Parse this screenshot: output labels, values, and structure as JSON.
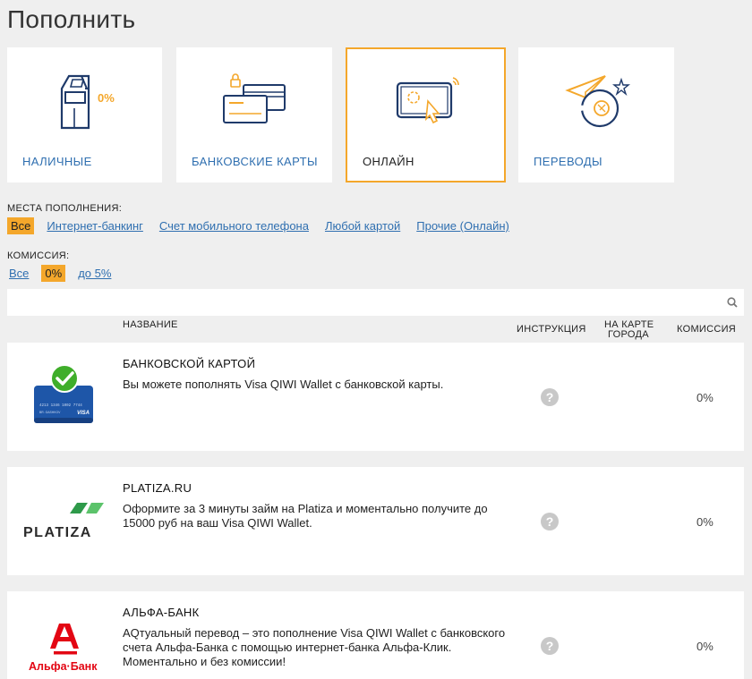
{
  "page": {
    "title": "Пополнить"
  },
  "categories": [
    {
      "label": "НАЛИЧНЫЕ",
      "icon": "cash-terminal-icon",
      "badge": "0%"
    },
    {
      "label": "БАНКОВСКИЕ КАРТЫ",
      "icon": "bank-cards-icon"
    },
    {
      "label": "ОНЛАЙН",
      "icon": "online-tablet-icon",
      "active": true
    },
    {
      "label": "ПЕРЕВОДЫ",
      "icon": "transfer-plane-icon"
    }
  ],
  "filters": {
    "places_title": "МЕСТА ПОПОЛНЕНИЯ:",
    "places": [
      "Все",
      "Интернет-банкинг",
      "Счет мобильного телефона",
      "Любой картой",
      "Прочие (Онлайн)"
    ],
    "places_selected": "Все",
    "fee_title": "КОМИССИЯ:",
    "fees": [
      "Все",
      "0%",
      "до 5%"
    ],
    "fee_selected": "0%"
  },
  "search": {
    "placeholder": "",
    "value": ""
  },
  "table": {
    "headers": {
      "name": "НАЗВАНИЕ",
      "instruction": "ИНСТРУКЦИЯ",
      "map_line1": "НА КАРТЕ",
      "map_line2": "ГОРОДА",
      "fee": "КОМИССИЯ"
    },
    "rows": [
      {
        "name": "БАНКОВСКОЙ КАРТОЙ",
        "description": "Вы можете пополнять Visa QIWI Wallet с банковской карты.",
        "fee": "0%",
        "logo": "bank-card-check-logo",
        "card_number": "4213 1346 1002 7744",
        "card_holder": "BR. GASHKOV",
        "card_brand": "VISA"
      },
      {
        "name": "PLATIZA.RU",
        "description": "Оформите за 3 минуты займ на Platiza и моментально получите до 15000 руб на ваш Visa QIWI Wallet.",
        "fee": "0%",
        "logo": "platiza-logo",
        "logo_text": "PLATIZA"
      },
      {
        "name": "АЛЬФА-БАНК",
        "description": "AQтуальный перевод – это пополнение Visa QIWI Wallet с банковского счета Альфа-Банка с помощью интернет-банка Альфа-Клик. Моментально и без комиссии!",
        "fee": "0%",
        "logo": "alfa-bank-logo",
        "logo_text": "Альфа·Банк"
      }
    ]
  },
  "colors": {
    "accent": "#f4a72b",
    "link": "#2f6fb0",
    "navy": "#1f3a6a",
    "platiza_green": "#2e9a4a",
    "alfa_red": "#e30613"
  }
}
